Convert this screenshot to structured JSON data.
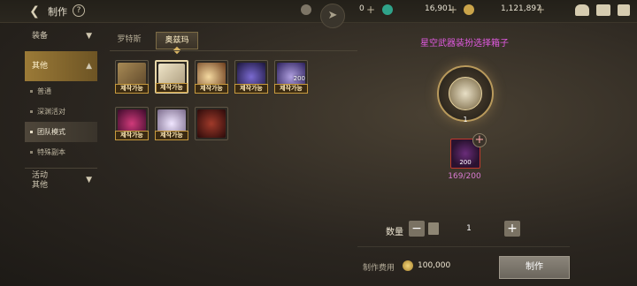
{
  "header": {
    "title": "制作",
    "help": "?",
    "currencies": [
      {
        "icon": "stamina-icon",
        "value": "0"
      },
      {
        "icon": "gem-icon",
        "value": "16,901"
      },
      {
        "icon": "gold-icon",
        "value": "1,121,897"
      }
    ]
  },
  "sidebar": {
    "cat1": "装备",
    "cat2": "其他",
    "subs": [
      "普通",
      "深渊活对",
      "团队模式",
      "特殊副本"
    ],
    "cat3_line1": "活动",
    "cat3_line2": "其他"
  },
  "tabs": [
    "罗特斯",
    "奥兹玛"
  ],
  "items": [
    {
      "tag": "제작가능",
      "color": "#8a6a3a"
    },
    {
      "tag": "제작가능",
      "color": "#d5c9a6"
    },
    {
      "tag": "제작가능",
      "color": "#b07a3a"
    },
    {
      "tag": "제작가능",
      "color": "#4a3a8a"
    },
    {
      "tag": "제작가능",
      "count": "200",
      "color": "#6a5aa0"
    },
    {
      "tag": "제작가능",
      "color": "#8a2a4a"
    },
    {
      "tag": "제작가능",
      "color": "#b8a8c8"
    },
    {
      "tag": "",
      "color": "#7a2a2a"
    }
  ],
  "right": {
    "title": "星空武器装扮选择箱子",
    "result_count": "1",
    "material_count": "200",
    "material_progress": "169/200",
    "qty_label": "数量",
    "qty_value": "1",
    "minus": "−",
    "plus": "+",
    "fee_label": "制作费用",
    "fee_value": "100,000",
    "craft_button": "制作"
  }
}
